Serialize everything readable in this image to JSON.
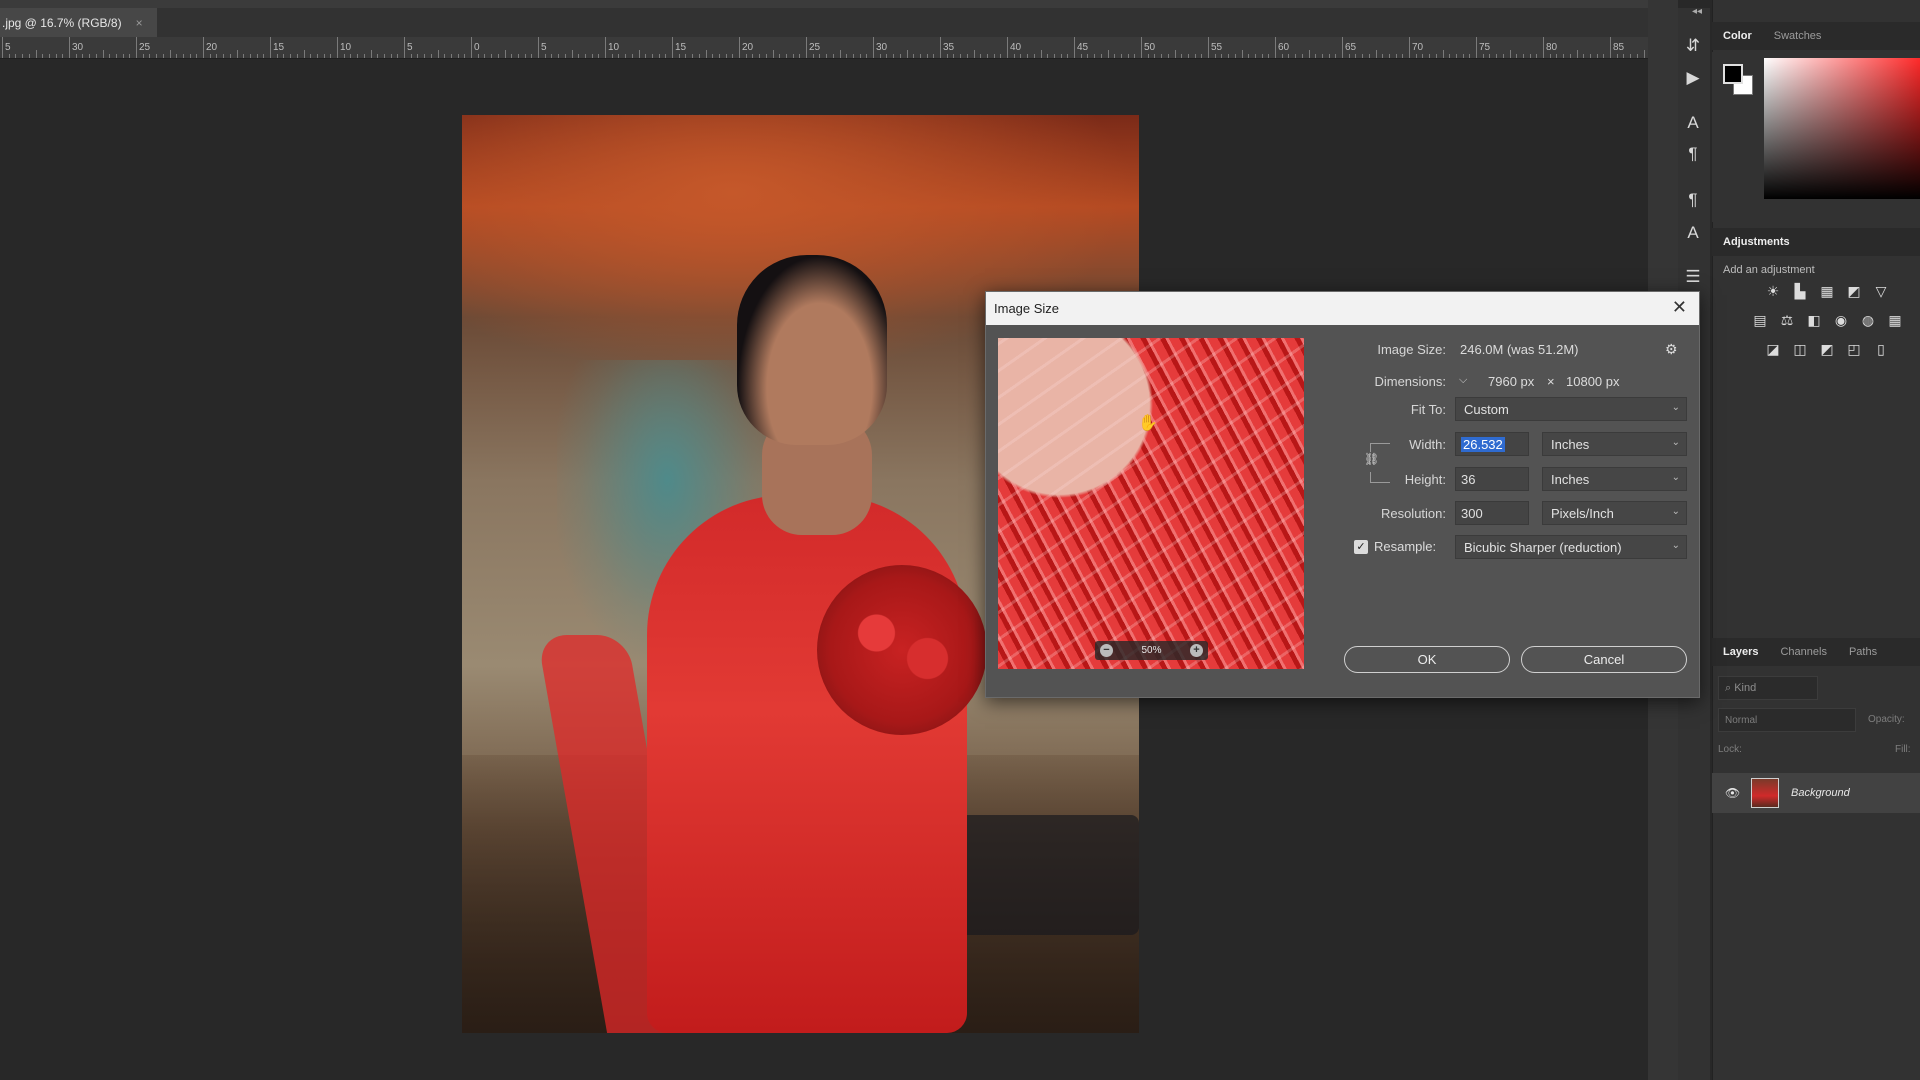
{
  "document_tab": {
    "title": ".jpg @ 16.7% (RGB/8)",
    "close": "×"
  },
  "ruler": {
    "labels": [
      "5",
      "30",
      "25",
      "20",
      "15",
      "10",
      "5",
      "0",
      "5",
      "10",
      "15",
      "20",
      "25",
      "30",
      "35",
      "40",
      "45",
      "50",
      "55",
      "60",
      "65",
      "70",
      "75",
      "80",
      "85"
    ]
  },
  "color_panel": {
    "tabs": [
      "Color",
      "Swatches"
    ],
    "foreground": "#000000",
    "background": "#ffffff",
    "hue": "#ff2a2a"
  },
  "adjustments_panel": {
    "title": "Adjustments",
    "subtitle": "Add an adjustment"
  },
  "layers_panel": {
    "tabs": [
      "Layers",
      "Channels",
      "Paths"
    ],
    "kind_placeholder": "Kind",
    "blend_mode": "Normal",
    "opacity_label": "Opacity:",
    "lock_label": "Lock:",
    "fill_label": "Fill:",
    "layer": {
      "name": "Background"
    }
  },
  "dialog": {
    "title": "Image Size",
    "image_size_label": "Image Size:",
    "image_size_value": "246.0M (was 51.2M)",
    "dimensions_label": "Dimensions:",
    "dim_width": "7960 px",
    "dim_x": "×",
    "dim_height": "10800 px",
    "fit_to_label": "Fit To:",
    "fit_to_value": "Custom",
    "width_label": "Width:",
    "width_value": "26.532",
    "width_unit": "Inches",
    "height_label": "Height:",
    "height_value": "36",
    "height_unit": "Inches",
    "resolution_label": "Resolution:",
    "resolution_value": "300",
    "resolution_unit": "Pixels/Inch",
    "resample_label": "Resample:",
    "resample_checked": true,
    "resample_value": "Bicubic Sharper (reduction)",
    "preview_zoom": "50%",
    "ok_label": "OK",
    "cancel_label": "Cancel"
  }
}
